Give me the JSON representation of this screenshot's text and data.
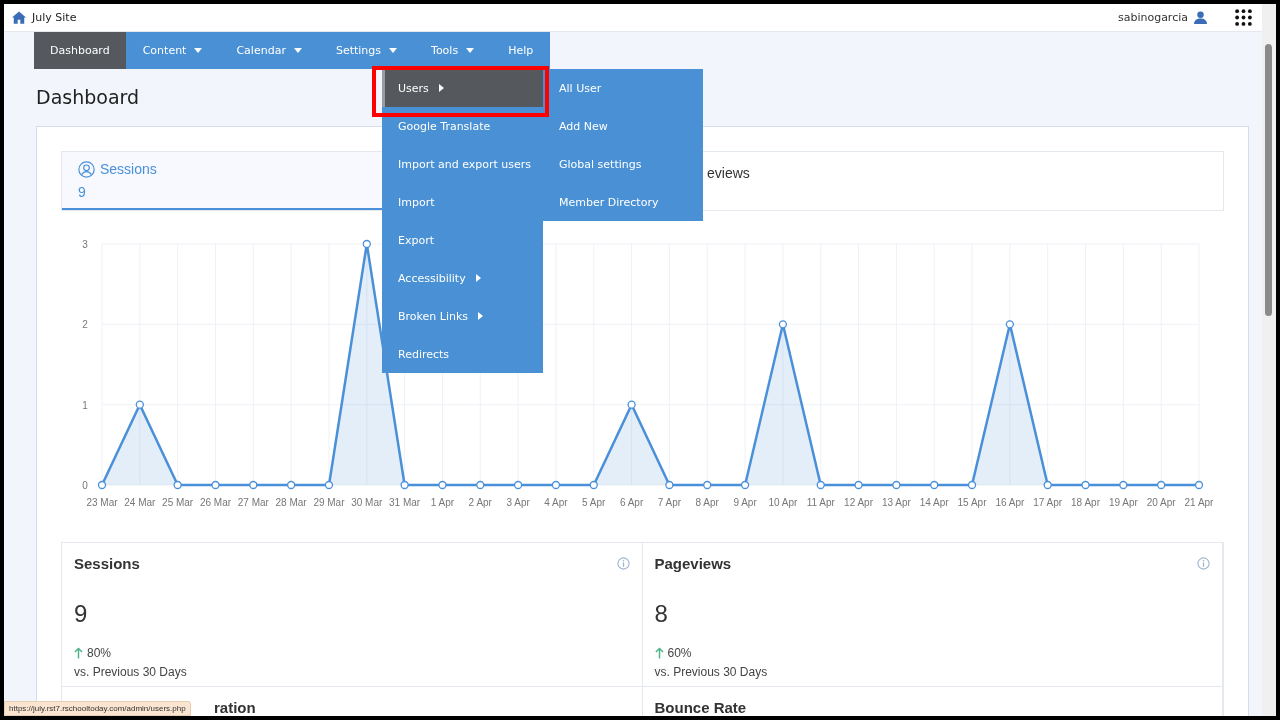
{
  "site": {
    "title": "July Site",
    "user": "sabinogarcia"
  },
  "nav": [
    {
      "label": "Dashboard",
      "selected": true,
      "dropdown": false
    },
    {
      "label": "Content",
      "selected": false,
      "dropdown": true
    },
    {
      "label": "Calendar",
      "selected": false,
      "dropdown": true
    },
    {
      "label": "Settings",
      "selected": false,
      "dropdown": true
    },
    {
      "label": "Tools",
      "selected": false,
      "dropdown": true
    },
    {
      "label": "Help",
      "selected": false,
      "dropdown": false
    }
  ],
  "tools_menu": [
    {
      "label": "Users",
      "selected": true,
      "submenu": true,
      "annotated": true
    },
    {
      "label": "Google Translate",
      "selected": false,
      "submenu": false,
      "annotated": false
    },
    {
      "label": "Import and export users",
      "selected": false,
      "submenu": false,
      "annotated": false
    },
    {
      "label": "Import",
      "selected": false,
      "submenu": false,
      "annotated": false
    },
    {
      "label": "Export",
      "selected": false,
      "submenu": false,
      "annotated": false
    },
    {
      "label": "Accessibility",
      "selected": false,
      "submenu": true,
      "annotated": false
    },
    {
      "label": "Broken Links",
      "selected": false,
      "submenu": true,
      "annotated": false
    },
    {
      "label": "Redirects",
      "selected": false,
      "submenu": false,
      "annotated": false
    }
  ],
  "users_submenu": [
    "All User",
    "Add New",
    "Global settings",
    "Member Directory"
  ],
  "heading": "Dashboard",
  "metric_tabs": [
    {
      "label": "Sessions",
      "value": "9",
      "selected": true
    },
    {
      "label": "eviews",
      "selected": false
    }
  ],
  "chart_data": {
    "type": "area",
    "categories": [
      "23 Mar",
      "24 Mar",
      "25 Mar",
      "26 Mar",
      "27 Mar",
      "28 Mar",
      "29 Mar",
      "30 Mar",
      "31 Mar",
      "1 Apr",
      "2 Apr",
      "3 Apr",
      "4 Apr",
      "5 Apr",
      "6 Apr",
      "7 Apr",
      "8 Apr",
      "9 Apr",
      "10 Apr",
      "11 Apr",
      "12 Apr",
      "13 Apr",
      "14 Apr",
      "15 Apr",
      "16 Apr",
      "17 Apr",
      "18 Apr",
      "19 Apr",
      "20 Apr",
      "21 Apr"
    ],
    "series": [
      {
        "color": "#4a90d9",
        "values": [
          0,
          1,
          0,
          0,
          0,
          0,
          0,
          3,
          0,
          0,
          0,
          0,
          0,
          0,
          1,
          0,
          0,
          0,
          2,
          0,
          0,
          0,
          0,
          0,
          2,
          0,
          0,
          0,
          0,
          0
        ]
      }
    ],
    "grid": true,
    "ylim": [
      0,
      3
    ],
    "yticks": [
      0,
      1,
      2,
      3
    ]
  },
  "stats": [
    {
      "title": "Sessions",
      "value": "9",
      "change": "80%",
      "compare": "vs. Previous 30 Days"
    },
    {
      "title": "Pageviews",
      "value": "8",
      "change": "60%",
      "compare": "vs. Previous 30 Days"
    },
    {
      "title": "ration"
    },
    {
      "title": "Bounce Rate"
    }
  ],
  "status_url": "https://july.rst7.rschooltoday.com/admin/users.php"
}
